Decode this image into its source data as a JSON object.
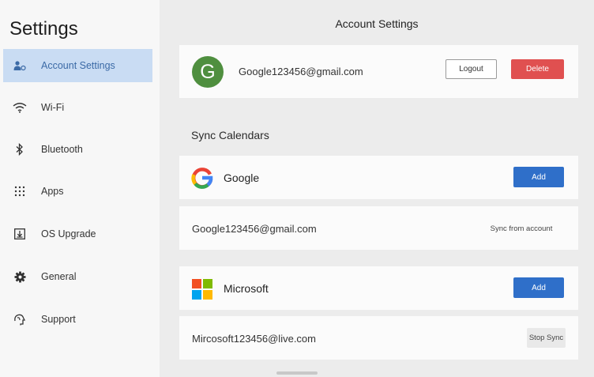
{
  "sidebar": {
    "title": "Settings",
    "items": [
      {
        "label": "Account Settings",
        "icon": "account-icon",
        "active": true
      },
      {
        "label": "Wi-Fi",
        "icon": "wifi-icon"
      },
      {
        "label": "Bluetooth",
        "icon": "bluetooth-icon"
      },
      {
        "label": "Apps",
        "icon": "apps-icon"
      },
      {
        "label": "OS Upgrade",
        "icon": "os-upgrade-icon"
      },
      {
        "label": "General",
        "icon": "gear-icon"
      },
      {
        "label": "Support",
        "icon": "support-icon"
      }
    ]
  },
  "main": {
    "title": "Account Settings",
    "account": {
      "avatar_letter": "G",
      "email": "Google123456@gmail.com",
      "logout_label": "Logout",
      "delete_label": "Delete"
    },
    "sync_title": "Sync Calendars",
    "google": {
      "name": "Google",
      "add_label": "Add",
      "account_email": "Google123456@gmail.com",
      "action_label": "Sync from account"
    },
    "microsoft": {
      "name": "Microsoft",
      "add_label": "Add",
      "account_email": "Mircosoft123456@live.com",
      "action_label": "Stop Sync"
    }
  },
  "colors": {
    "accent": "#2f6fc9",
    "active_bg": "#c9dcf3",
    "delete": "#e05050",
    "avatar": "#4f8f3f"
  }
}
